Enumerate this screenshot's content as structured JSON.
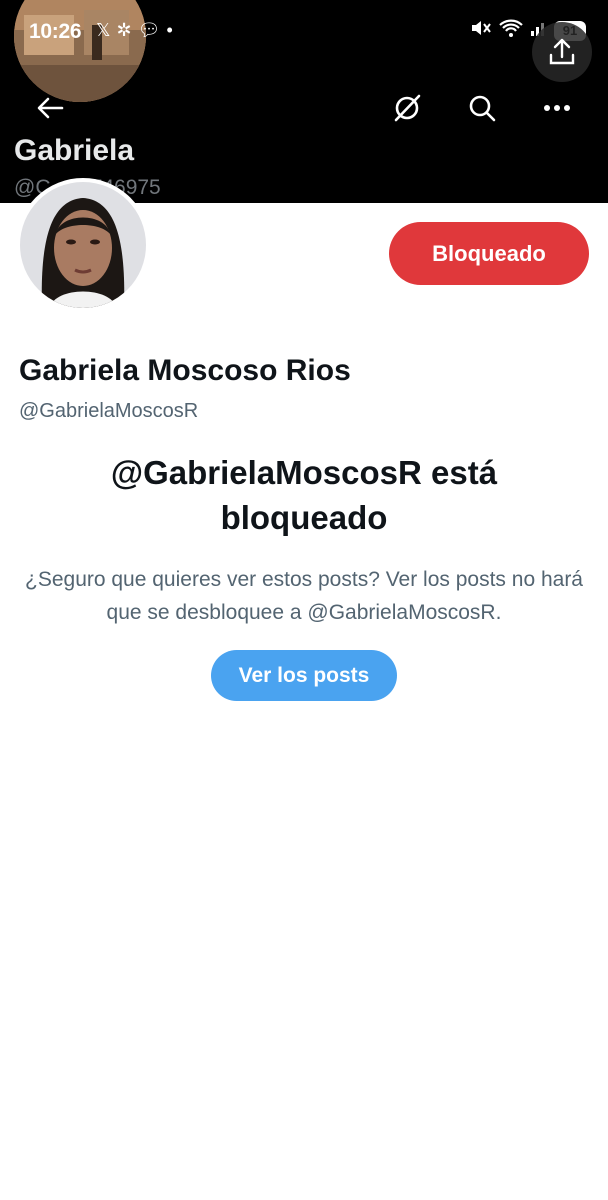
{
  "status_bar": {
    "time": "10:26",
    "battery": "91",
    "signal_superscript": "5"
  },
  "header": {
    "banner_name": "Gabriela",
    "banner_handle": "@C    09746975",
    "icons": [
      "back-arrow-icon",
      "grok-icon",
      "search-icon",
      "more-icon",
      "share-icon"
    ]
  },
  "profile": {
    "display_name": "Gabriela Moscoso Rios",
    "handle": "@GabrielaMoscosR",
    "blocked_button_label": "Bloqueado"
  },
  "blocked_notice": {
    "title": "@GabrielaMoscosR está bloqueado",
    "description": "¿Seguro que quieres ver estos posts? Ver los posts no hará que se desbloquee a @GabrielaMoscosR.",
    "view_posts_label": "Ver los posts"
  },
  "colors": {
    "blocked_button": "#e0383b",
    "view_posts_button": "#4aa3f0",
    "banner": "#000000",
    "secondary_text": "#536471"
  }
}
